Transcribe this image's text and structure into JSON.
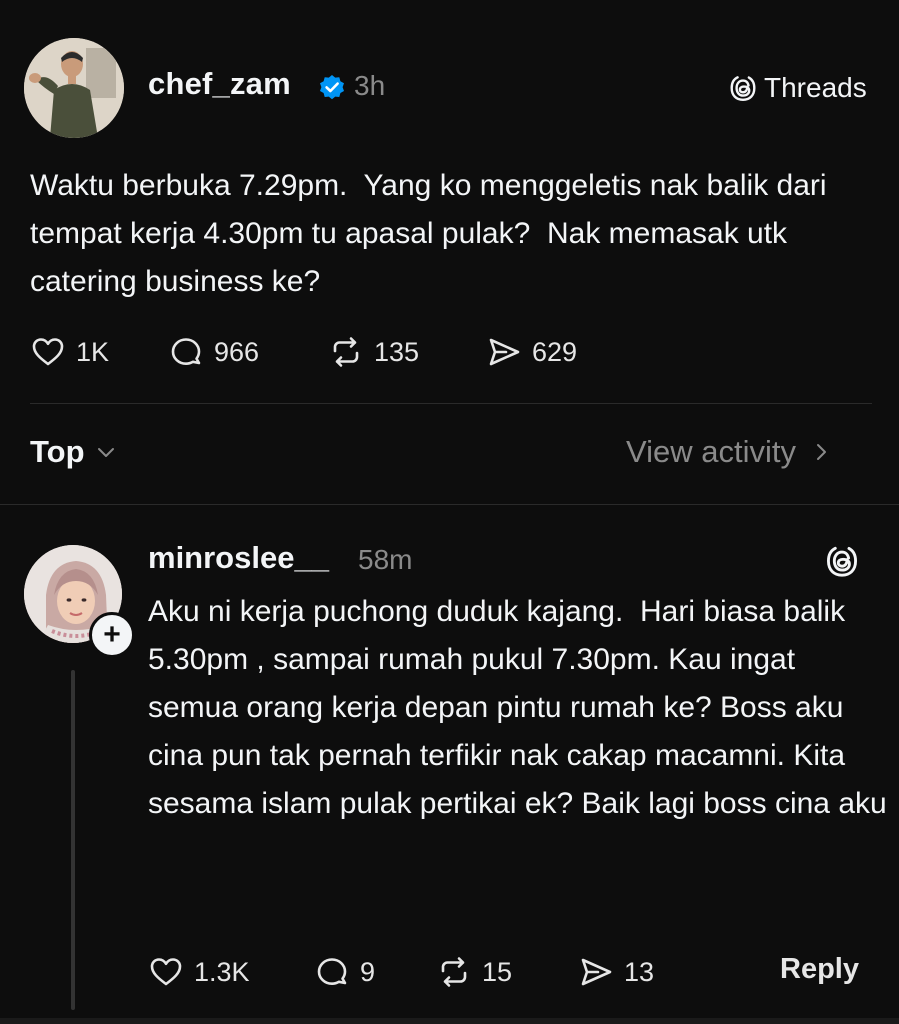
{
  "post": {
    "username": "chef_zam",
    "verified": true,
    "time": "3h",
    "brand": "Threads",
    "text": "Waktu berbuka 7.29pm.  Yang ko menggeletis nak balik dari tempat kerja 4.30pm tu apasal pulak?  Nak memasak utk catering business ke?",
    "likes": "1K",
    "comments": "966",
    "reposts": "135",
    "shares": "629"
  },
  "sort": {
    "label": "Top",
    "view_activity": "View activity"
  },
  "reply": {
    "username": "minroslee__",
    "time": "58m",
    "text": "Aku ni kerja puchong duduk kajang.  Hari biasa balik 5.30pm , sampai rumah pukul 7.30pm. Kau ingat semua orang kerja depan pintu rumah ke? Boss aku cina pun tak pernah terfikir nak cakap macamni. Kita sesama islam pulak pertikai ek? Baik lagi boss cina aku",
    "likes": "1.3K",
    "comments": "9",
    "reposts": "15",
    "shares": "13",
    "reply_label": "Reply",
    "follow_badge": "+"
  },
  "colors": {
    "background": "#0d0d0d",
    "text": "#f3f5f7",
    "muted": "#8a8a8a",
    "verified_blue": "#0095f6"
  },
  "icons": [
    "heart-icon",
    "comment-icon",
    "repost-icon",
    "share-icon",
    "threads-logo-icon",
    "verified-badge-icon",
    "chevron-down-icon",
    "chevron-right-icon"
  ]
}
